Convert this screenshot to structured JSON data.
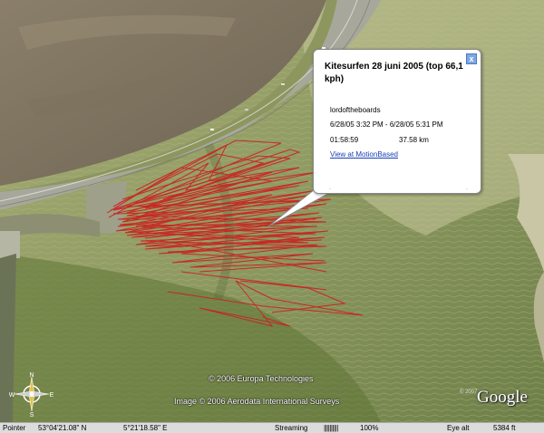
{
  "balloon": {
    "title": "Kitesurfen 28 juni 2005 (top 66,1 kph)",
    "author": "lordoftheboards",
    "date_range": "6/28/05 3:32 PM - 6/28/05 5:31 PM",
    "duration": "01:58:59",
    "distance": "37.58 km",
    "link": "View at MotionBased",
    "close_symbol": "x"
  },
  "copyright": {
    "line1": "© 2006 Europa Technologies",
    "line2": "Image © 2006 Aerodata International Surveys",
    "small": "© 2007",
    "logo": "Google"
  },
  "compass": {
    "n": "N",
    "s": "S",
    "e": "E",
    "w": "W"
  },
  "statusbar": {
    "pointer_label": "Pointer",
    "lat": "53°04'21.08\" N",
    "lon": "5°21'18.58\"  E",
    "streaming_label": "Streaming",
    "streaming_bar": "||||||||||",
    "streaming_pct": "100%",
    "eye_alt_label": "Eye  alt",
    "eye_alt_value": "5384 ft"
  },
  "colors": {
    "track": "#cc1f1f",
    "link": "#1a3fb5"
  }
}
